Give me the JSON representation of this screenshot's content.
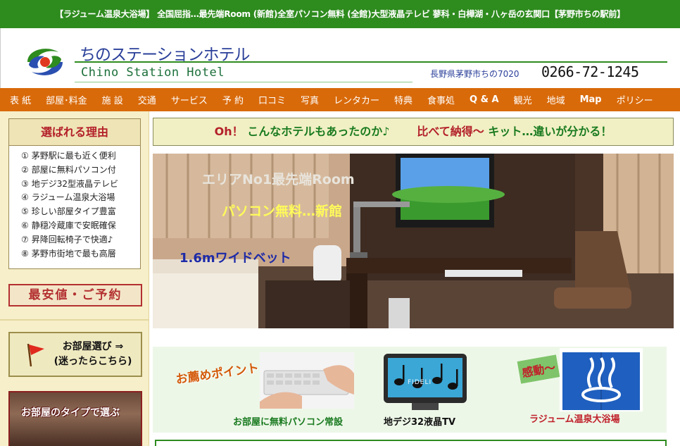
{
  "banner": {
    "text": "【ラジューム温泉大浴場】 全国屈指…最先端Room (新館)全室パソコン無料 (全館)大型液晶テレビ 蓼科・白樺湖・八ヶ岳の玄関口【茅野市ちの駅前】"
  },
  "header": {
    "name_jp": "ちのステーションホテル",
    "name_en": "Chino Station Hotel",
    "address": "長野県茅野市ちの7020",
    "phone": "0266-72-1245"
  },
  "nav": {
    "items": [
      "表 紙",
      "部屋･料金",
      "施 設",
      "交通",
      "サービス",
      "予 約",
      "口コミ",
      "写真",
      "レンタカー",
      "特典",
      "食事処",
      "Q & A",
      "観光",
      "地域",
      "Map",
      "ポリシー"
    ]
  },
  "sidebar": {
    "reasons_title": "選ばれる理由",
    "reasons": [
      {
        "num": "①",
        "text": "茅野駅に最も近く便利"
      },
      {
        "num": "②",
        "text": "部屋に無料パソコン付"
      },
      {
        "num": "③",
        "text": "地デジ32型液晶テレビ"
      },
      {
        "num": "④",
        "text": "ラジューム温泉大浴場"
      },
      {
        "num": "⑤",
        "text": "珍しい部屋タイプ豊富"
      },
      {
        "num": "⑥",
        "text": "静穏冷蔵庫で安眠確保"
      },
      {
        "num": "⑦",
        "text": "昇降回転椅子で快適♪"
      },
      {
        "num": "⑧",
        "text": "茅野市街地で最も高層"
      }
    ],
    "cheapest_button": "最安値・ご予約",
    "room_select_line1": "お部屋選び ⇒",
    "room_select_line2": "(迷ったらこちら)",
    "room_type_label": "お部屋のタイプで選ぶ"
  },
  "main": {
    "headline_part1": "Oh！",
    "headline_part2": "こんなホテルもあったのか♪",
    "headline_part3": "比べて納得～",
    "headline_part4": "キット…違いが分かる！",
    "photo_caption_1": "エリアNo1最先端Room",
    "photo_caption_2": "パソコン無料…新館",
    "photo_caption_3": "1.6mワイドベット",
    "recommend_label": "お薦めポイント",
    "feature_1": "お部屋に無料パソコン常設",
    "feature_2": "地デジ32液晶TV",
    "feature_3": "ラジューム温泉大浴場",
    "kando": "感動～",
    "tv_brand": "FIDELI"
  },
  "colors": {
    "banner_green": "#2e8b1e",
    "nav_orange": "#d96a0a",
    "sidebar_cream": "#f6efc9",
    "accent_red": "#b3202a",
    "title_blue": "#2a3f99"
  }
}
